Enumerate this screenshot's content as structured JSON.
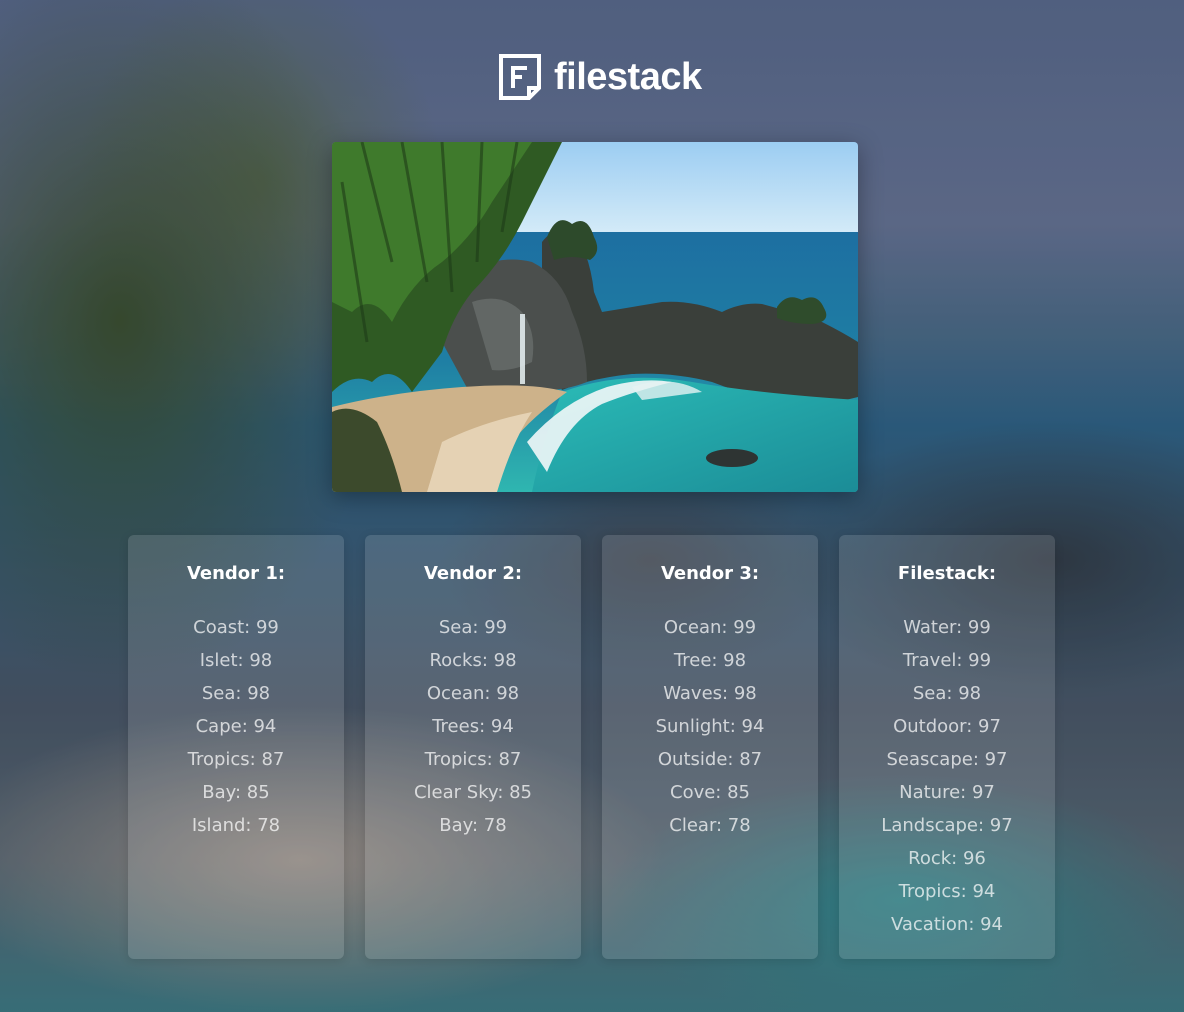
{
  "brand": {
    "name": "filestack",
    "logo_icon": "filestack-logo-icon"
  },
  "hero_image": {
    "icon": "coastal-cove-photo"
  },
  "panels": [
    {
      "title": "Vendor 1:",
      "tags": [
        "Coast: 99",
        "Islet: 98",
        "Sea: 98",
        "Cape: 94",
        "Tropics: 87",
        "Bay: 85",
        "Island: 78"
      ]
    },
    {
      "title": "Vendor 2:",
      "tags": [
        "Sea: 99",
        "Rocks: 98",
        "Ocean: 98",
        "Trees: 94",
        "Tropics: 87",
        "Clear Sky: 85",
        "Bay: 78"
      ]
    },
    {
      "title": "Vendor 3:",
      "tags": [
        "Ocean: 99",
        "Tree: 98",
        "Waves: 98",
        "Sunlight: 94",
        "Outside: 87",
        "Cove: 85",
        "Clear: 78"
      ]
    },
    {
      "title": "Filestack:",
      "tags": [
        "Water: 99",
        "Travel: 99",
        "Sea: 98",
        "Outdoor: 97",
        "Seascape: 97",
        "Nature: 97",
        "Landscape: 97",
        "Rock: 96",
        "Tropics: 94",
        "Vacation: 94"
      ]
    }
  ],
  "colors": {
    "text": "#ffffff",
    "tag_text": "rgba(255,255,255,0.72)",
    "panel_bg": "rgba(255,255,255,0.13)"
  }
}
